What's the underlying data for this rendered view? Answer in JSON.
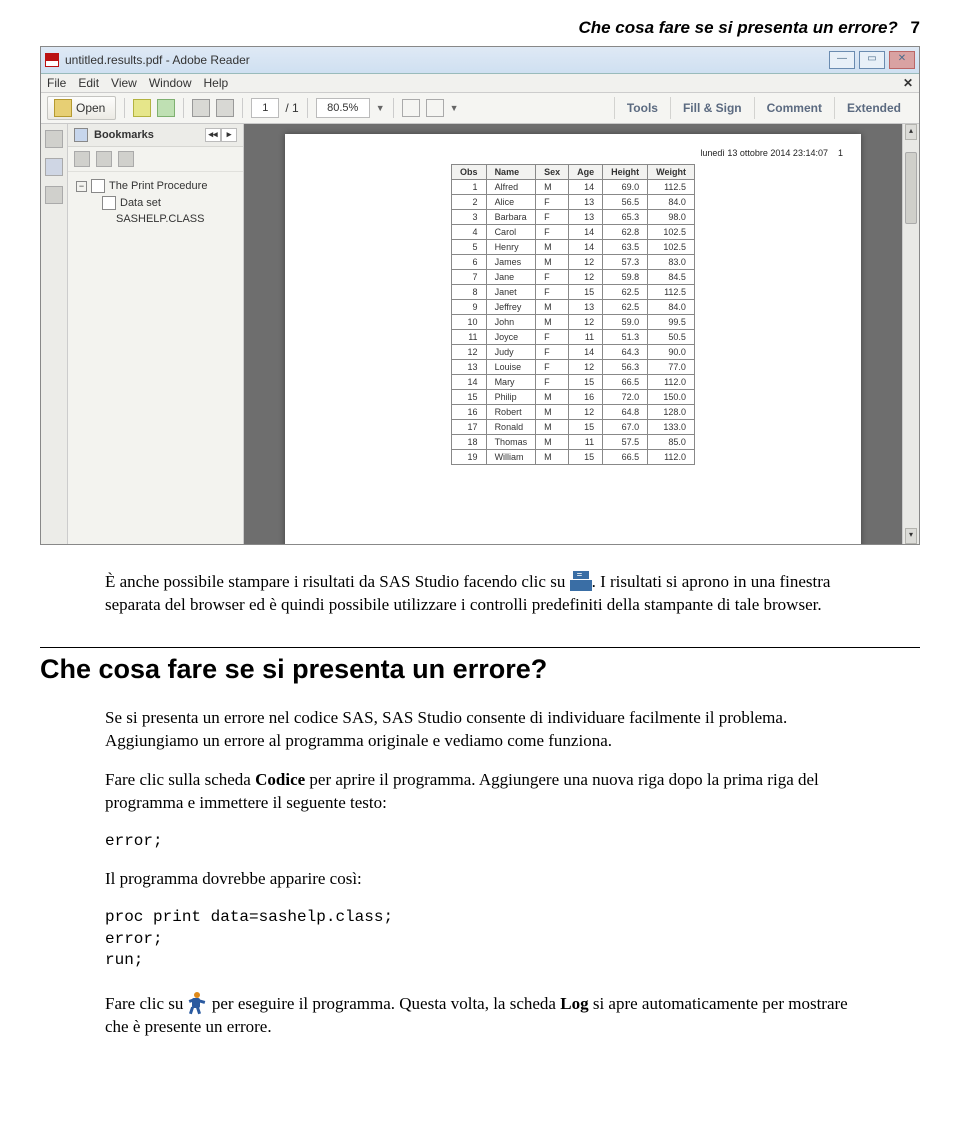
{
  "header": {
    "title": "Che cosa fare se si presenta un errore?",
    "page": "7"
  },
  "reader": {
    "window_title": "untitled.results.pdf - Adobe Reader",
    "menu": [
      "File",
      "Edit",
      "View",
      "Window",
      "Help"
    ],
    "open_label": "Open",
    "page_current": "1",
    "page_total": "/ 1",
    "zoom": "80.5%",
    "right_tabs": [
      "Tools",
      "Fill & Sign",
      "Comment",
      "Extended"
    ],
    "bookmarks_title": "Bookmarks",
    "tree": {
      "root": "The Print Procedure",
      "child1": "Data set",
      "child2": "SASHELP.CLASS"
    },
    "doc_meta_date": "lunedì 13 ottobre 2014 23:14:07",
    "doc_meta_page": "1",
    "table": {
      "headers": [
        "Obs",
        "Name",
        "Sex",
        "Age",
        "Height",
        "Weight"
      ],
      "rows": [
        [
          "1",
          "Alfred",
          "M",
          "14",
          "69.0",
          "112.5"
        ],
        [
          "2",
          "Alice",
          "F",
          "13",
          "56.5",
          "84.0"
        ],
        [
          "3",
          "Barbara",
          "F",
          "13",
          "65.3",
          "98.0"
        ],
        [
          "4",
          "Carol",
          "F",
          "14",
          "62.8",
          "102.5"
        ],
        [
          "5",
          "Henry",
          "M",
          "14",
          "63.5",
          "102.5"
        ],
        [
          "6",
          "James",
          "M",
          "12",
          "57.3",
          "83.0"
        ],
        [
          "7",
          "Jane",
          "F",
          "12",
          "59.8",
          "84.5"
        ],
        [
          "8",
          "Janet",
          "F",
          "15",
          "62.5",
          "112.5"
        ],
        [
          "9",
          "Jeffrey",
          "M",
          "13",
          "62.5",
          "84.0"
        ],
        [
          "10",
          "John",
          "M",
          "12",
          "59.0",
          "99.5"
        ],
        [
          "11",
          "Joyce",
          "F",
          "11",
          "51.3",
          "50.5"
        ],
        [
          "12",
          "Judy",
          "F",
          "14",
          "64.3",
          "90.0"
        ],
        [
          "13",
          "Louise",
          "F",
          "12",
          "56.3",
          "77.0"
        ],
        [
          "14",
          "Mary",
          "F",
          "15",
          "66.5",
          "112.0"
        ],
        [
          "15",
          "Philip",
          "M",
          "16",
          "72.0",
          "150.0"
        ],
        [
          "16",
          "Robert",
          "M",
          "12",
          "64.8",
          "128.0"
        ],
        [
          "17",
          "Ronald",
          "M",
          "15",
          "67.0",
          "133.0"
        ],
        [
          "18",
          "Thomas",
          "M",
          "11",
          "57.5",
          "85.0"
        ],
        [
          "19",
          "William",
          "M",
          "15",
          "66.5",
          "112.0"
        ]
      ]
    }
  },
  "para1a": "È anche possibile stampare i risultati da SAS Studio facendo clic su ",
  "para1b": ". I risultati si aprono in una finestra separata del browser ed è quindi possibile utilizzare i controlli predefiniti della stampante di tale browser.",
  "section_title": "Che cosa fare se si presenta un errore?",
  "para2": "Se si presenta un errore nel codice SAS, SAS Studio consente di individuare facilmente il problema. Aggiungiamo un errore al programma originale e vediamo come funziona.",
  "para3a": "Fare clic sulla scheda ",
  "para3b": "Codice",
  "para3c": " per aprire il programma. Aggiungere una nuova riga dopo la prima riga del programma e immettere il seguente testo:",
  "code1": "error;",
  "para4": "Il programma dovrebbe apparire così:",
  "code2a": "proc print data=sashelp.class;",
  "code2b": "error;",
  "code2c": "run;",
  "para5a": "Fare clic su ",
  "para5b": " per eseguire il programma. Questa volta, la scheda ",
  "para5c": "Log",
  "para5d": " si apre automaticamente per mostrare che è presente un errore."
}
